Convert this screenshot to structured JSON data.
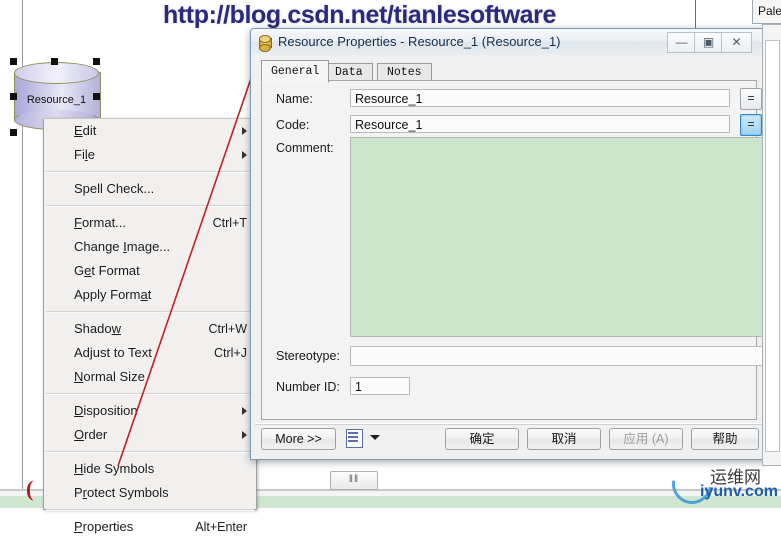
{
  "watermark_url": "http://blog.csdn.net/tianlesoftware",
  "colors": {
    "accent_blue": "#2e87c4",
    "comment_green": "#cbe5cb",
    "annotation_red": "#b01c1c",
    "title_text": "#12304c",
    "url_navy": "#2b2b7a"
  },
  "canvas": {
    "symbol": {
      "label": "Resource_1",
      "shape": "cylinder"
    }
  },
  "context_menu": {
    "groups": [
      [
        {
          "label": "Edit",
          "accel": "",
          "submenu": true,
          "mnemonic": 0
        },
        {
          "label": "File",
          "accel": "",
          "submenu": true,
          "mnemonic": 2
        }
      ],
      [
        {
          "label": "Spell Check...",
          "accel": "",
          "submenu": false,
          "mnemonic": -1
        }
      ],
      [
        {
          "label": "Format...",
          "accel": "Ctrl+T",
          "submenu": false,
          "mnemonic": 0
        },
        {
          "label": "Change Image...",
          "accel": "",
          "submenu": false,
          "mnemonic": 7
        },
        {
          "label": "Get Format",
          "accel": "",
          "submenu": false,
          "mnemonic": 1
        },
        {
          "label": "Apply Format",
          "accel": "",
          "submenu": false,
          "mnemonic": 10
        }
      ],
      [
        {
          "label": "Shadow",
          "accel": "Ctrl+W",
          "submenu": false,
          "mnemonic": 5
        },
        {
          "label": "Adjust to Text",
          "accel": "Ctrl+J",
          "submenu": false,
          "mnemonic": -1
        },
        {
          "label": "Normal Size",
          "accel": "",
          "submenu": false,
          "mnemonic": 0
        }
      ],
      [
        {
          "label": "Disposition",
          "accel": "",
          "submenu": true,
          "mnemonic": 0
        },
        {
          "label": "Order",
          "accel": "",
          "submenu": true,
          "mnemonic": 0
        }
      ],
      [
        {
          "label": "Hide Symbols",
          "accel": "",
          "submenu": false,
          "mnemonic": 0
        },
        {
          "label": "Protect Symbols",
          "accel": "",
          "submenu": false,
          "mnemonic": 1
        }
      ],
      [
        {
          "label": "Properties",
          "accel": "Alt+Enter",
          "submenu": false,
          "mnemonic": 0
        }
      ]
    ]
  },
  "dialog": {
    "title": "Resource Properties - Resource_1 (Resource_1)",
    "icon": "cylinder-icon",
    "window_buttons": {
      "minimize": "—",
      "maximize": "▣",
      "close": "✕"
    },
    "tabs": [
      {
        "label": "General",
        "active": true
      },
      {
        "label": "Data",
        "active": false
      },
      {
        "label": "Notes",
        "active": false
      }
    ],
    "fields": {
      "name_label": "Name:",
      "name_value": "Resource_1",
      "code_label": "Code:",
      "code_value": "Resource_1",
      "comment_label": "Comment:",
      "comment_value": "",
      "stereotype_label": "Stereotype:",
      "stereotype_value": "",
      "number_id_label": "Number ID:",
      "number_id_value": "1",
      "equals_button_label": "="
    },
    "footer": {
      "more_label": "More >>",
      "ok_label": "确定",
      "cancel_label": "取消",
      "apply_label": "应用 (A)",
      "apply_disabled": true,
      "help_label": "帮助"
    }
  },
  "right_panel": {
    "title": "Palet"
  },
  "statusbar": {
    "scroll_thumb_label": "‖‖"
  },
  "logo_watermark": {
    "cn": "运维网",
    "en": "iyunv.com"
  }
}
